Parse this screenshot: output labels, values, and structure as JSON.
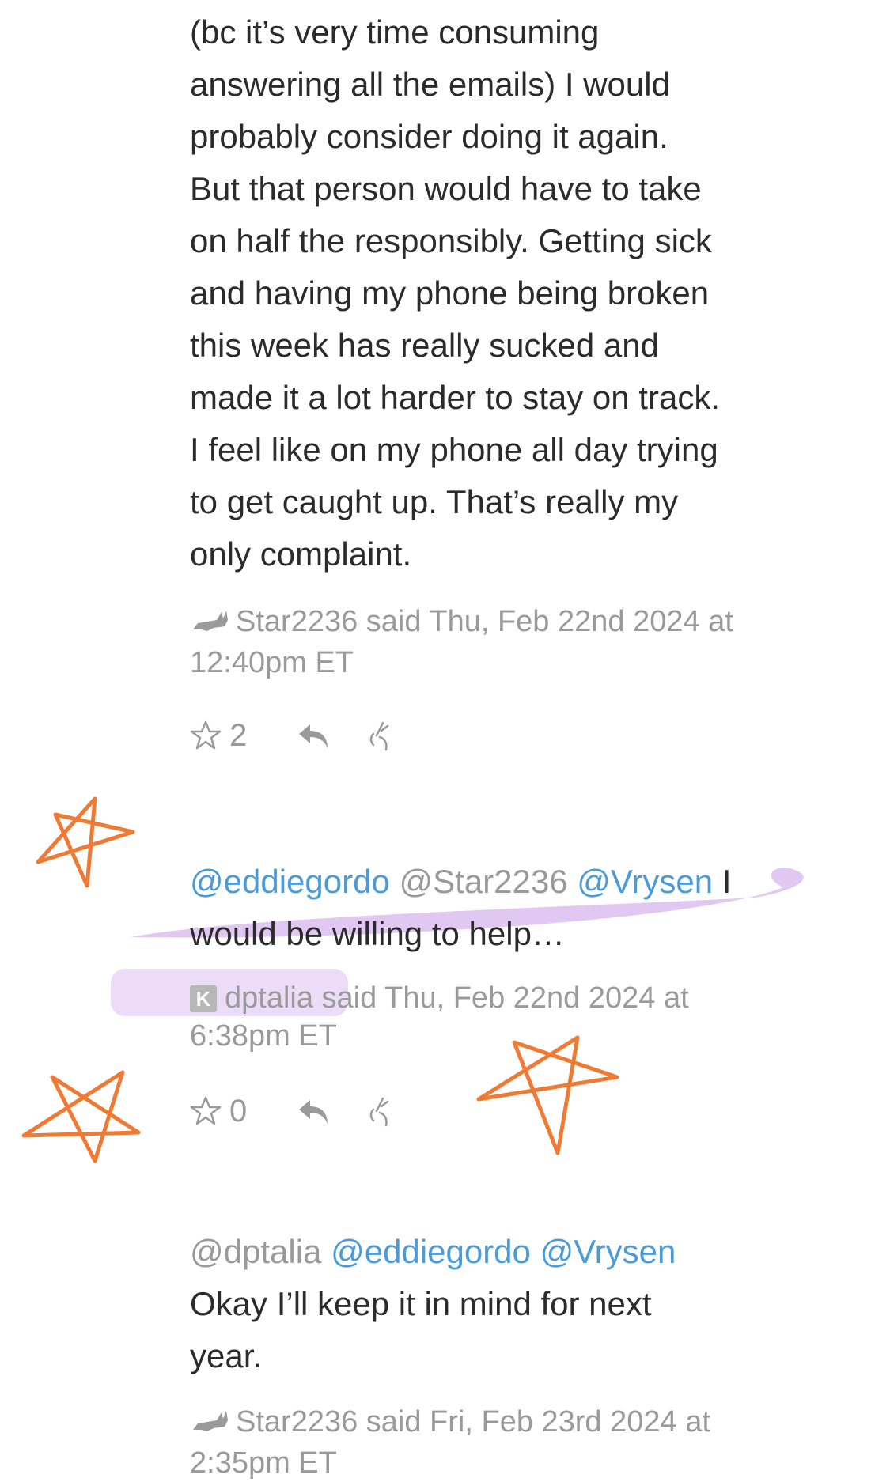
{
  "comments": [
    {
      "lines": [
        "(bc it’s very time consuming",
        "answering all the emails) I would",
        "probably consider doing it again.",
        "But that person would have to take",
        "on half the responsibly. Getting sick",
        "and having my phone being broken",
        "this week has really sucked and",
        "made it a lot harder to stay on track.",
        "I feel like on my phone all day trying",
        "to get caught up. That’s really my",
        "only complaint."
      ],
      "meta_line1": "Star2236 said Thu, Feb 22nd 2024 at",
      "meta_line2": "12:40pm ET",
      "star_count": "2"
    },
    {
      "mention_1": "@eddiegordo",
      "mention_2": "@Star2236",
      "mention_3": "@Vrysen",
      "line1_tail": "I",
      "line2": "would be willing to help…",
      "badge": "K",
      "meta_user": "dptalia",
      "meta_rest": "said Thu, Feb 22nd 2024 at",
      "meta_line2": "6:38pm ET",
      "star_count": "0"
    },
    {
      "mention_1": "@dptalia",
      "mention_2": "@eddiegordo",
      "mention_3": "@Vrysen",
      "line2": "Okay I’ll keep it in mind for next",
      "line3": "year.",
      "meta_line1": "Star2236 said Fri, Feb 23rd 2024 at",
      "meta_line2": "2:35pm ET"
    }
  ],
  "colors": {
    "mention": "#4b9bd9",
    "meta": "#9a9a9a",
    "annotation_orange": "#ee7a33",
    "annotation_highlight": "#c99ae8"
  },
  "icons": [
    "star-icon",
    "reply-icon",
    "flag-hand-icon",
    "cat-avatar-icon"
  ]
}
